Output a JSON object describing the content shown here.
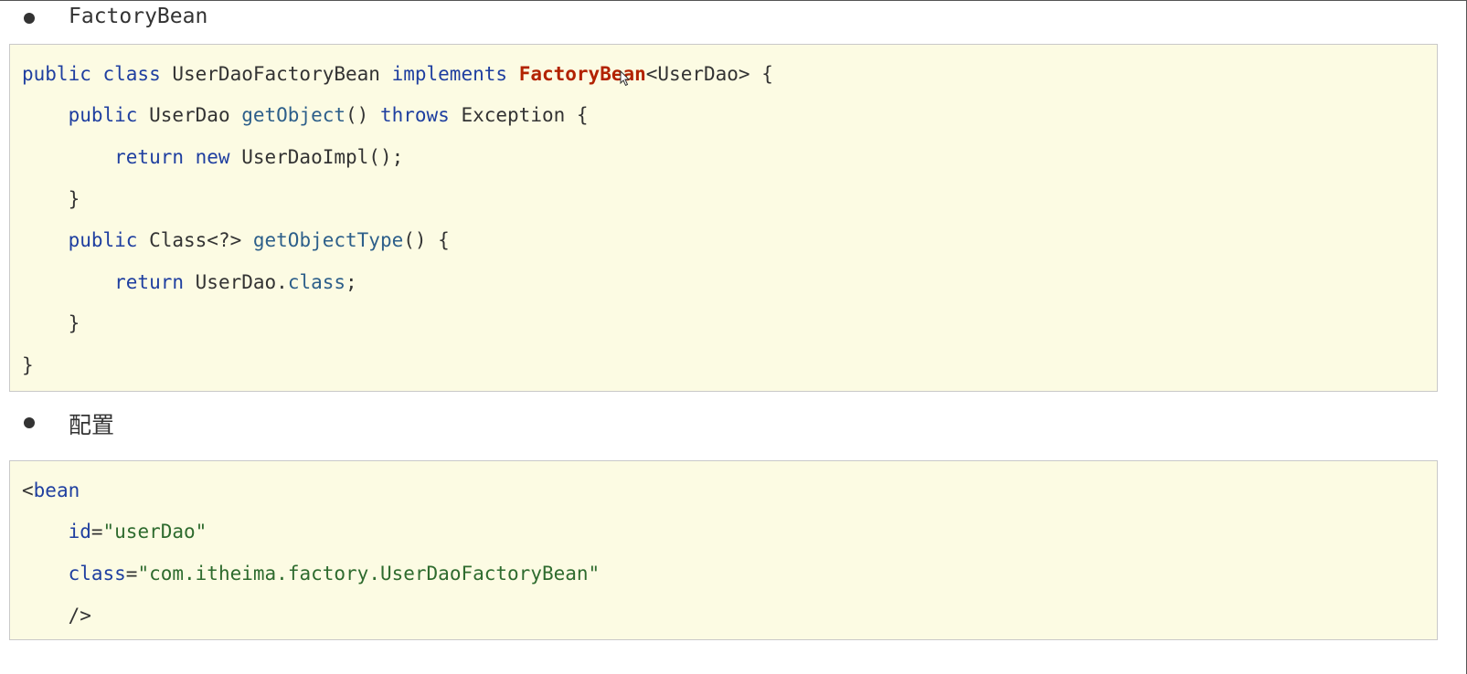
{
  "bullets": [
    {
      "text": "FactoryBean"
    },
    {
      "text": "配置"
    }
  ],
  "java_code": {
    "line1": {
      "t1": "public class",
      "t2": " UserDaoFactoryBean ",
      "t3": "implements",
      "t4": " ",
      "t5": "FactoryBean",
      "t6": "<UserDao> {"
    },
    "line2": {
      "t1": "    public",
      "t2": " UserDao ",
      "t3": "getObject",
      "t4": "() ",
      "t5": "throws",
      "t6": " Exception {"
    },
    "line3": {
      "t1": "        return new",
      "t2": " UserDaoImpl();"
    },
    "line4": {
      "t1": "    }"
    },
    "line5": {
      "t1": "    public",
      "t2": " Class<?> ",
      "t3": "getObjectType",
      "t4": "() {"
    },
    "line6": {
      "t1": "        return",
      "t2": " UserDao.",
      "t3": "class",
      "t4": ";"
    },
    "line7": {
      "t1": "    }"
    },
    "line8": {
      "t1": "}"
    }
  },
  "xml_code": {
    "line1": {
      "t1": "<",
      "t2": "bean"
    },
    "line2": {
      "t1": "    id",
      "t2": "=",
      "t3": "\"userDao\""
    },
    "line3": {
      "t1": "    class",
      "t2": "=",
      "t3": "\"com.itheima.factory.UserDaoFactoryBean\""
    },
    "line4": {
      "t1": "    />"
    }
  },
  "colors": {
    "keyword": "#1f3fa0",
    "function": "#2d5f8a",
    "highlight": "#b22200",
    "string": "#2e6b2e",
    "code_background": "#fcfbe3"
  },
  "icons": {
    "cursor": "mouse-pointer-icon"
  }
}
